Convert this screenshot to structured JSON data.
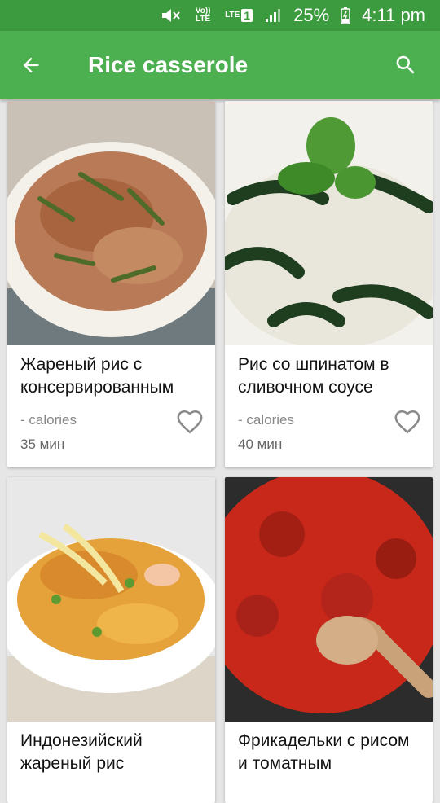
{
  "status_bar": {
    "volte_label": "Vo)) LTE",
    "lte_label": "LTE",
    "sim_slot": "1",
    "battery": "25%",
    "time": "4:11 pm"
  },
  "app_bar": {
    "title": "Rice casserole",
    "back_icon": "arrow-back-icon",
    "search_icon": "search-icon"
  },
  "recipes": [
    {
      "name": "Жареный рис с консервированным",
      "calories": "- calories",
      "time": "35 мин",
      "image": "fried-rice-photo"
    },
    {
      "name": "Рис со шпинатом в сливочном соусе",
      "calories": "- calories",
      "time": "40 мин",
      "image": "spinach-rice-photo"
    },
    {
      "name": "Индонезийский жареный рис",
      "calories": "",
      "time": "",
      "image": "indonesian-rice-photo"
    },
    {
      "name": "Фрикадельки с рисом и томатным",
      "calories": "",
      "time": "",
      "image": "meatballs-photo"
    }
  ],
  "colors": {
    "status_bar": "#3c9a3f",
    "app_bar": "#4caf50",
    "background": "#e6e6e6"
  }
}
